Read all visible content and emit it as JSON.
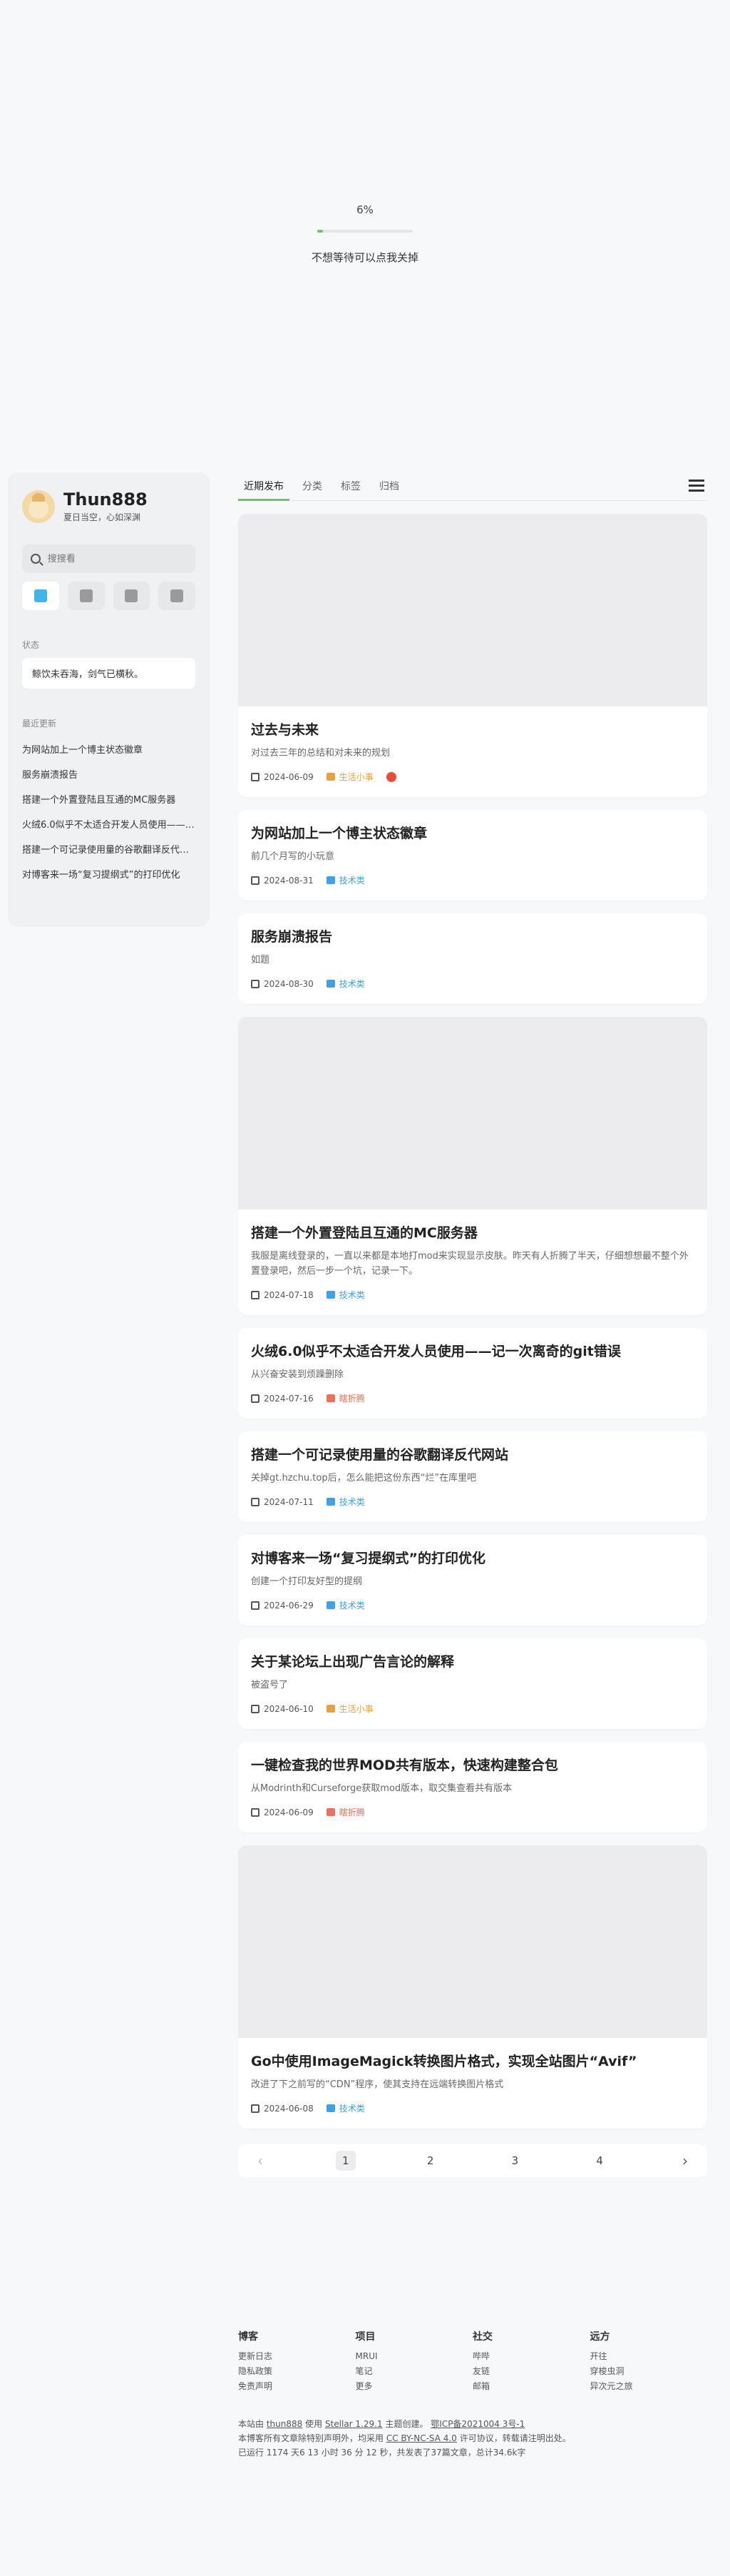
{
  "loader": {
    "percent_text": "6%",
    "progress": 0.06,
    "skip_text": "不想等待可以点我关掉"
  },
  "sidebar": {
    "title": "Thun888",
    "subtitle": "夏日当空，心如深渊",
    "search_placeholder": "搜搜看",
    "nav_icons": [
      "blog-icon",
      "wiki-icon",
      "notes-icon",
      "explore-icon"
    ],
    "status_label": "状态",
    "status_text": "鲸饮未吞海，剑气已横秋。",
    "recent_label": "最近更新",
    "recent": [
      "为网站加上一个博主状态徽章",
      "服务崩溃报告",
      "搭建一个外置登陆且互通的MC服务器",
      "火绒6.0似乎不太适合开发人员使用——一...",
      "搭建一个可记录使用量的谷歌翻译反代网站",
      "对博客来一场“复习提纲式”的打印优化"
    ]
  },
  "tabs": [
    "近期发布",
    "分类",
    "标签",
    "归档"
  ],
  "posts": [
    {
      "title": "过去与未来",
      "excerpt": "对过去三年的总结和对未来的规划",
      "date": "2024-06-09",
      "category": "生活小事",
      "cat_color": "#e6a23c",
      "cover": true,
      "pin": true
    },
    {
      "title": "为网站加上一个博主状态徽章",
      "excerpt": "前几个月写的小玩意",
      "date": "2024-08-31",
      "category": "技术类",
      "cat_color": "#41a0e6",
      "cover": false,
      "pin": false
    },
    {
      "title": "服务崩溃报告",
      "excerpt": "如题",
      "date": "2024-08-30",
      "category": "技术类",
      "cat_color": "#41a0e6",
      "cover": false,
      "pin": false
    },
    {
      "title": "搭建一个外置登陆且互通的MC服务器",
      "excerpt": "我服是离线登录的，一直以来都是本地打mod来实现显示皮肤。昨天有人折腾了半天，仔细想想最不整个外置登录吧，然后一步一个坑，记录一下。",
      "date": "2024-07-18",
      "category": "技术类",
      "cat_color": "#41a0e6",
      "cover": true,
      "pin": false
    },
    {
      "title": "火绒6.0似乎不太适合开发人员使用——记一次离奇的git错误",
      "excerpt": "从兴奋安装到烦躁删除",
      "date": "2024-07-16",
      "category": "瞎折腾",
      "cat_color": "#e6735c",
      "cover": false,
      "pin": false
    },
    {
      "title": "搭建一个可记录使用量的谷歌翻译反代网站",
      "excerpt": "关掉gt.hzchu.top后，怎么能把这份东西“烂”在库里吧",
      "date": "2024-07-11",
      "category": "技术类",
      "cat_color": "#41a0e6",
      "cover": false,
      "pin": false
    },
    {
      "title": "对博客来一场“复习提纲式”的打印优化",
      "excerpt": "创建一个打印友好型的提纲",
      "date": "2024-06-29",
      "category": "技术类",
      "cat_color": "#41a0e6",
      "cover": false,
      "pin": false
    },
    {
      "title": "关于某论坛上出现广告言论的解释",
      "excerpt": "被盗号了",
      "date": "2024-06-10",
      "category": "生活小事",
      "cat_color": "#e6a23c",
      "cover": false,
      "pin": false
    },
    {
      "title": "一键检查我的世界MOD共有版本，快速构建整合包",
      "excerpt": "从Modrinth和Curseforge获取mod版本，取交集查看共有版本",
      "date": "2024-06-09",
      "category": "瞎折腾",
      "cat_color": "#e6735c",
      "cover": false,
      "pin": false
    },
    {
      "title": "Go中使用ImageMagick转换图片格式，实现全站图片“Avif”",
      "excerpt": "改进了下之前写的“CDN”程序，使其支持在远端转换图片格式",
      "date": "2024-06-08",
      "category": "技术类",
      "cat_color": "#41a0e6",
      "cover": true,
      "pin": false
    }
  ],
  "pager": {
    "prev": "‹",
    "next": "›",
    "pages": [
      "1",
      "2",
      "3",
      "4"
    ],
    "current": "1"
  },
  "footer": {
    "cols": [
      {
        "head": "博客",
        "links": [
          "更新日志",
          "隐私政策",
          "免责声明"
        ]
      },
      {
        "head": "项目",
        "links": [
          "MRUI",
          "笔记",
          "更多"
        ]
      },
      {
        "head": "社交",
        "links": [
          "哔哔",
          "友链",
          "邮箱"
        ]
      },
      {
        "head": "远方",
        "links": [
          "开往",
          "穿梭虫洞",
          "异次元之旅"
        ]
      }
    ],
    "line1_a": "本站由",
    "line1_name": "thun888",
    "line1_b": "使用",
    "line1_theme": "Stellar 1.29.1",
    "line1_c": "主题创建。",
    "line1_icp": "鄂ICP备2021004 3号-1",
    "line2_a": "本博客所有文章除特别声明外，均采用",
    "line2_license": "CC BY-NC-SA 4.0",
    "line2_b": "许可协议，转载请注明出处。",
    "line3": "已运行 1174 天6 13 小时 36 分 12 秒，共发表了37篇文章，总计34.6k字"
  }
}
